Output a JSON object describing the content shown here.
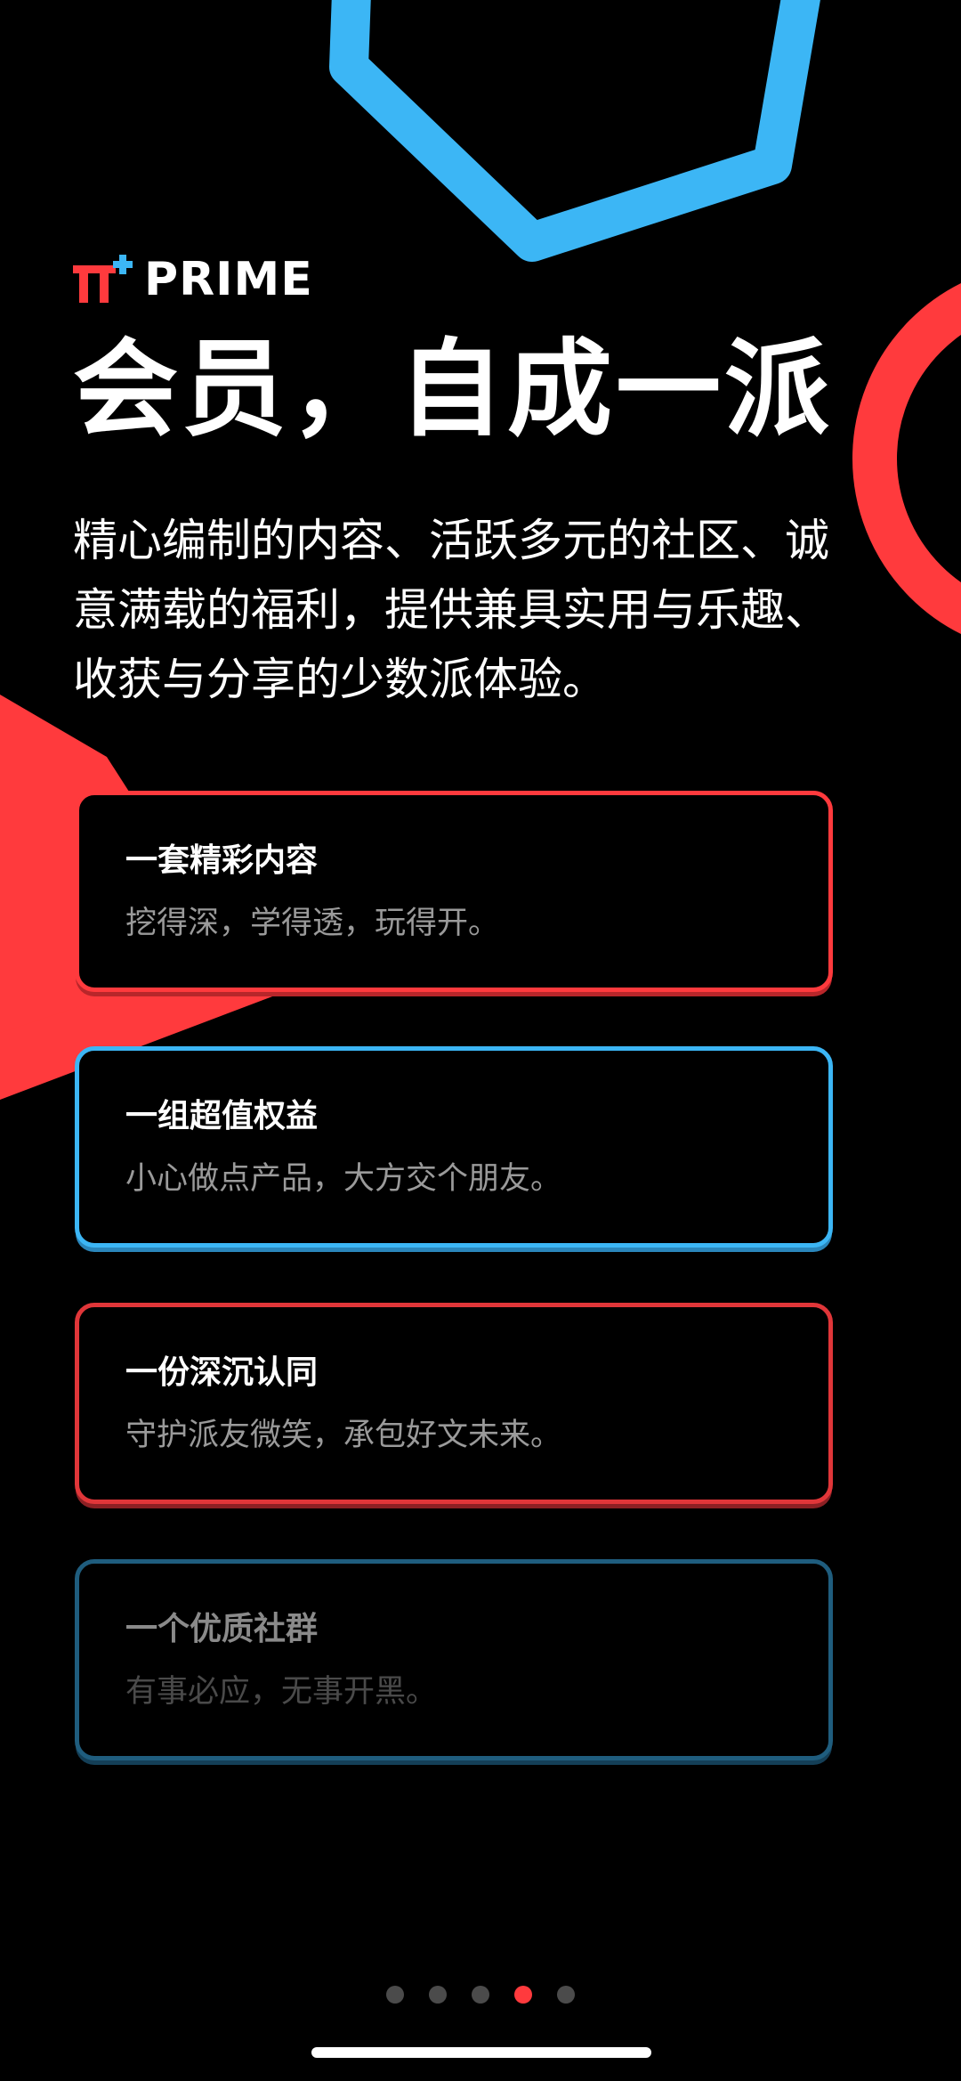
{
  "logo": {
    "text": "PRIME",
    "mark_icon": "pi-plus-logo",
    "mark_color": "#ff3a3d",
    "plus_color": "#3cb6f5"
  },
  "hero": {
    "title": "会员，自成一派",
    "description": "精心编制的内容、活跃多元的社区、诚意满载的福利，提供兼具实用与乐趣、收获与分享的少数派体验。"
  },
  "cards": [
    {
      "title": "一套精彩内容",
      "subtitle": "挖得深，学得透，玩得开。",
      "accent": "#ff3a3d"
    },
    {
      "title": "一组超值权益",
      "subtitle": "小心做点产品，大方交个朋友。",
      "accent": "#3cb6f5"
    },
    {
      "title": "一份深沉认同",
      "subtitle": "守护派友微笑，承包好文未来。",
      "accent": "#e03639"
    },
    {
      "title": "一个优质社群",
      "subtitle": "有事必应，无事开黑。",
      "accent": "#1f5d7e"
    }
  ],
  "pagination": {
    "total": 5,
    "current": 4
  },
  "colors": {
    "background": "#000000",
    "brand_red": "#ff3a3d",
    "brand_blue": "#3cb6f5"
  }
}
